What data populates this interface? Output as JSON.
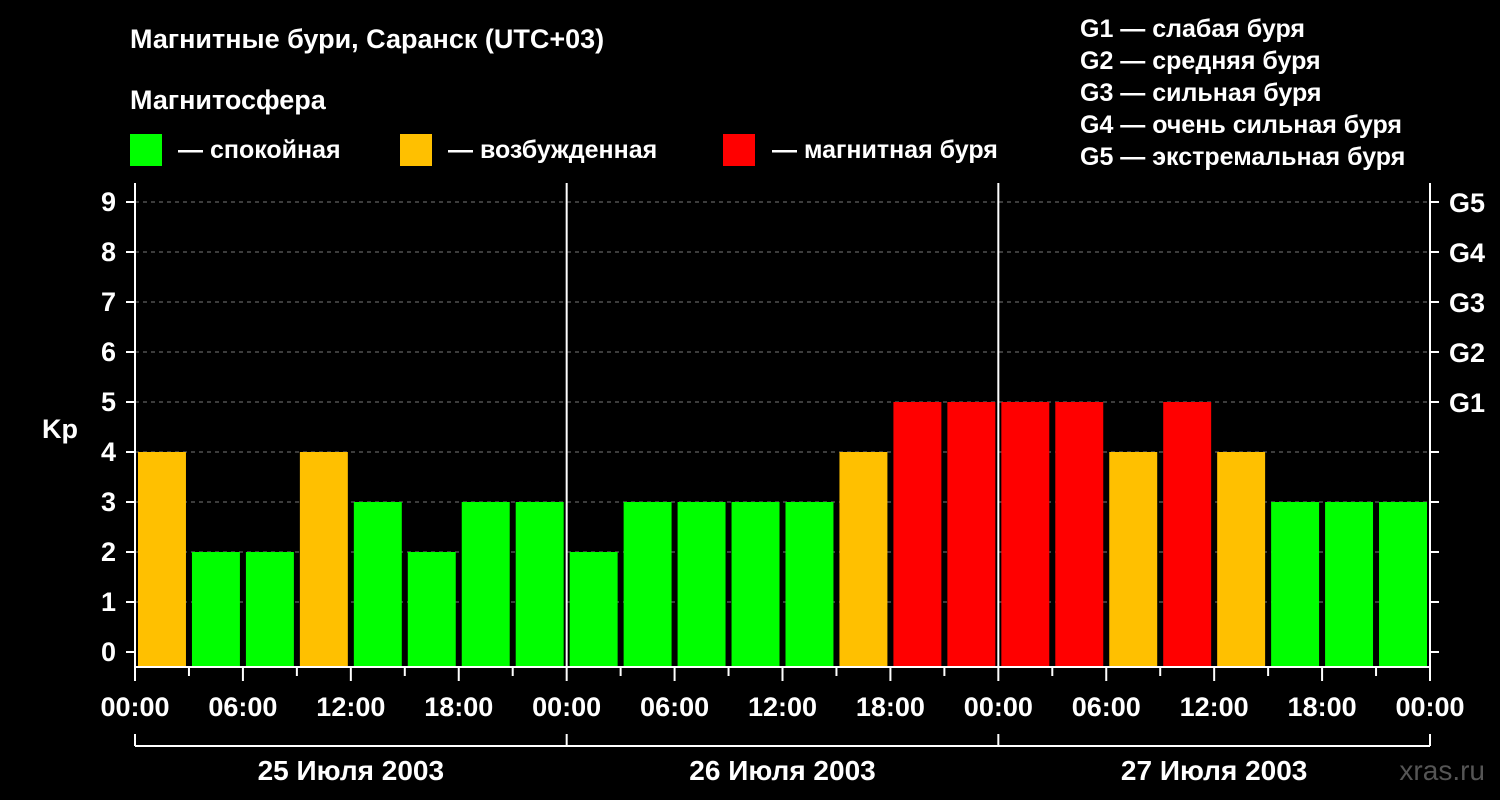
{
  "title": "Магнитные бури, Саранск (UTC+03)",
  "legend": {
    "heading": "Магнитосфера",
    "items": [
      {
        "label": "— спокойная",
        "color": "#00ff00"
      },
      {
        "label": "— возбужденная",
        "color": "#ffc000"
      },
      {
        "label": "— магнитная буря",
        "color": "#ff0000"
      }
    ]
  },
  "storm_scale": [
    "G1 — слабая буря",
    "G2 — средняя буря",
    "G3 — сильная буря",
    "G4 — очень сильная буря",
    "G5 — экстремальная буря"
  ],
  "watermark": "xras.ru",
  "chart_data": {
    "type": "bar",
    "ylabel": "Kp",
    "ylim": [
      0,
      9
    ],
    "y_ticks": [
      "0",
      "1",
      "2",
      "3",
      "4",
      "5",
      "6",
      "7",
      "8",
      "9"
    ],
    "right_ticks": [
      {
        "kp": 5,
        "label": "G1"
      },
      {
        "kp": 6,
        "label": "G2"
      },
      {
        "kp": 7,
        "label": "G3"
      },
      {
        "kp": 8,
        "label": "G4"
      },
      {
        "kp": 9,
        "label": "G5"
      }
    ],
    "x_tick_labels": [
      "00:00",
      "06:00",
      "12:00",
      "18:00",
      "00:00",
      "06:00",
      "12:00",
      "18:00",
      "00:00",
      "06:00",
      "12:00",
      "18:00",
      "00:00"
    ],
    "dates": [
      "25 Июля 2003",
      "26 Июля 2003",
      "27 Июля 2003"
    ],
    "interval_hours": 3,
    "values": [
      4,
      2,
      2,
      4,
      3,
      2,
      3,
      3,
      2,
      3,
      3,
      3,
      3,
      4,
      5,
      5,
      5,
      5,
      4,
      5,
      4,
      3,
      3,
      3
    ],
    "categories_legend": {
      "calm": {
        "max": 3,
        "color": "#00ff00"
      },
      "active": {
        "value": 4,
        "color": "#ffc000"
      },
      "storm": {
        "min": 5,
        "color": "#ff0000"
      }
    },
    "grid": "dashed horizontal"
  }
}
